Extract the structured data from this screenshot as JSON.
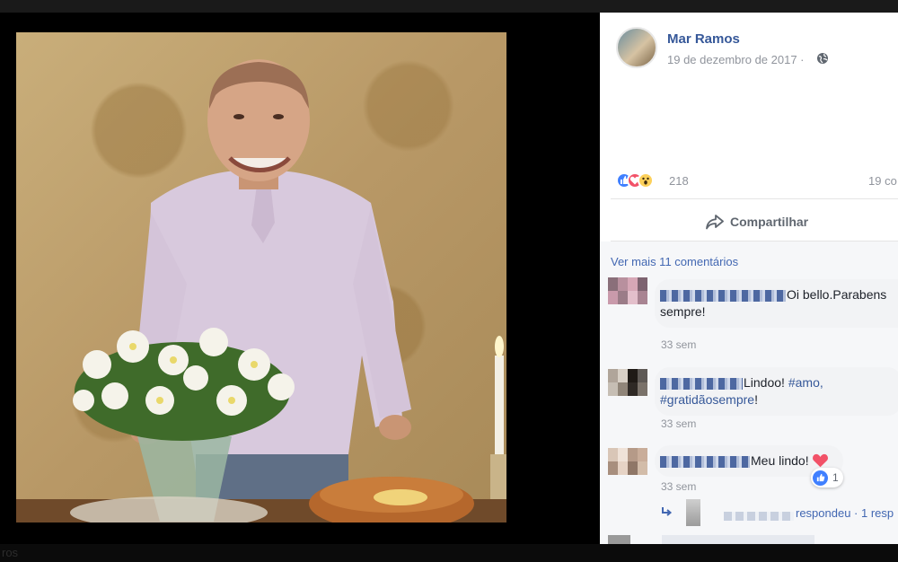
{
  "post": {
    "author": "Mar Ramos",
    "date": "19 de dezembro de 2017 ·",
    "privacy_icon": "globe-icon",
    "reaction_icons": [
      "like-icon",
      "love-icon",
      "wow-icon"
    ],
    "reaction_count": "218",
    "comment_count": "19 co",
    "share_label": "Compartilhar",
    "more_comments": "Ver mais 11 comentários"
  },
  "comments": [
    {
      "text_line1": "Oi bello.Parabens",
      "text_line2": "sempre!",
      "time": "33 sem"
    },
    {
      "text": "Lindoo!",
      "tag1": "#amo,",
      "tag2": "#gratidãosempre",
      "tail": "!",
      "time": "33 sem"
    },
    {
      "text": "Meu lindo!",
      "like_count": "1",
      "time": "33 sem"
    }
  ],
  "reply": {
    "text": "respondeu · 1 resp"
  },
  "background_ghost_text": "ros",
  "colors": {
    "link": "#365899",
    "like": "#4080ff",
    "love": "#f25268",
    "wow": "#fcd05a",
    "muted": "#90949c"
  }
}
